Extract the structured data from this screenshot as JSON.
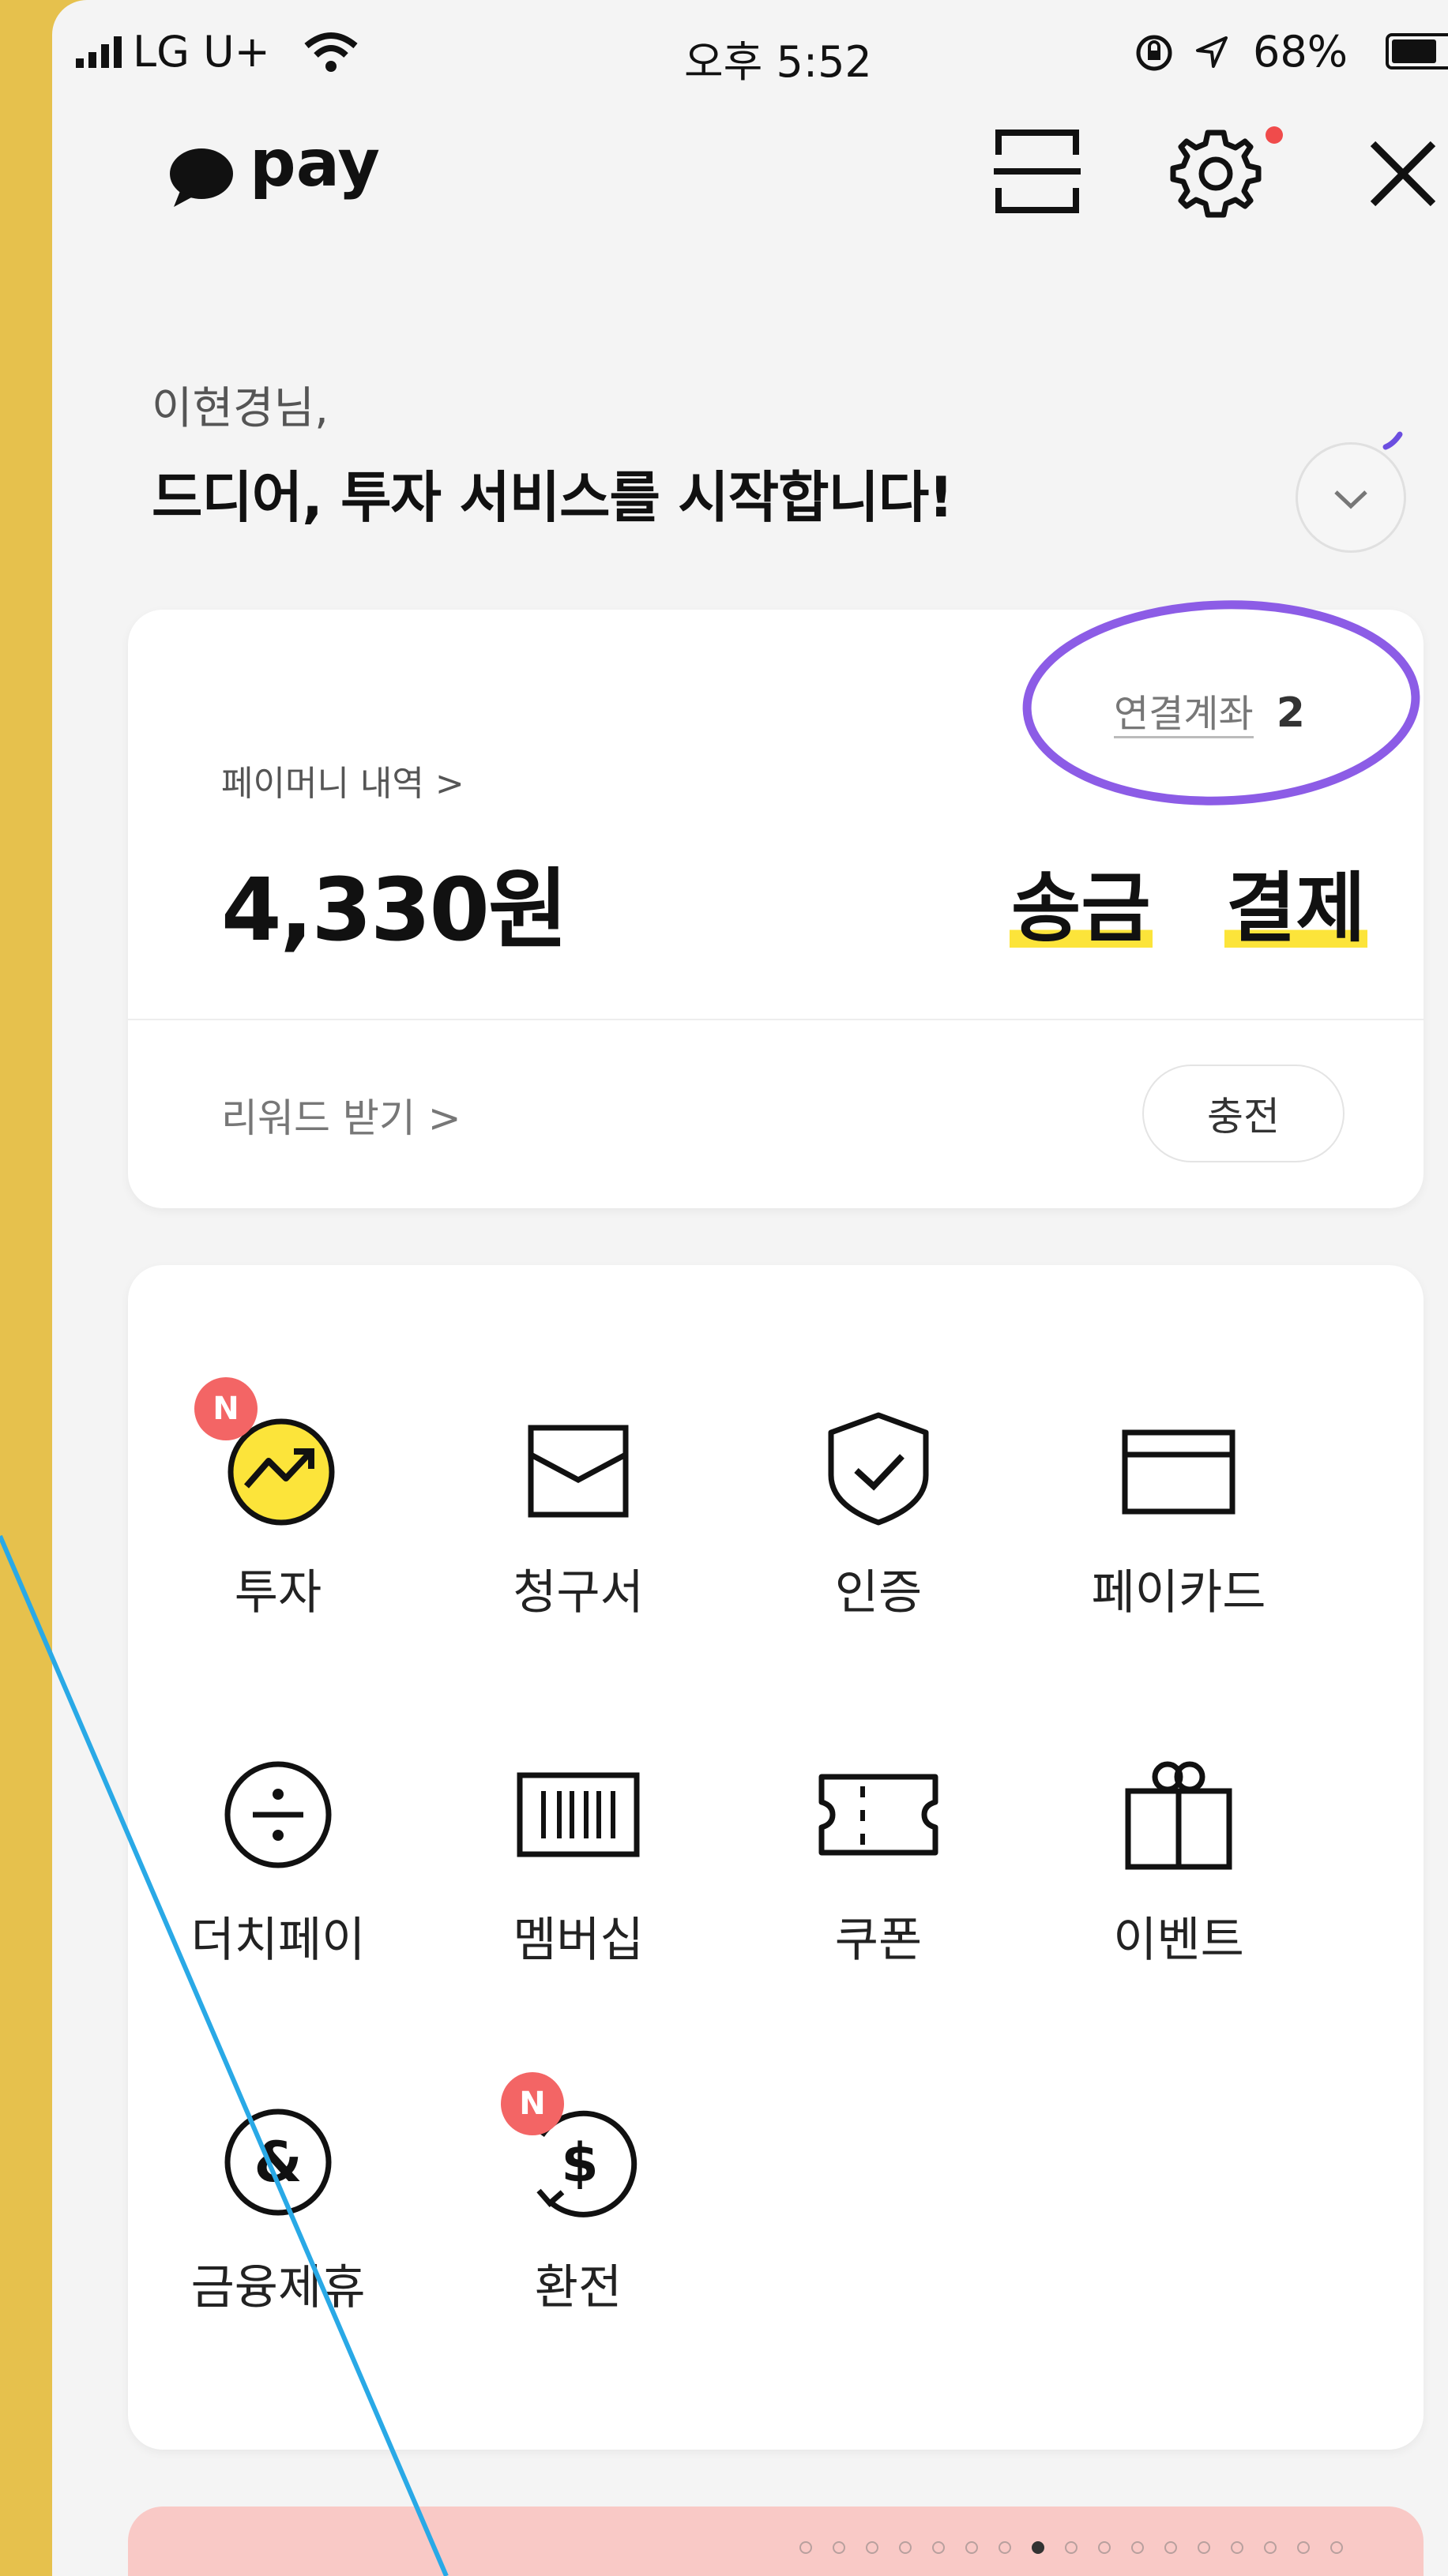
{
  "status_bar": {
    "carrier": "LG U+",
    "time": "오후 5:52",
    "battery": "68%"
  },
  "header": {
    "brand": "pay",
    "icons": [
      "chat-bubble-icon",
      "qr-scan-icon",
      "gear-icon",
      "close-icon"
    ],
    "settings_has_alert": true
  },
  "greeting": {
    "name": "이현경님,",
    "title": "드디어, 투자 서비스를 시작합니다!"
  },
  "money_card": {
    "history_link": "페이머니 내역 >",
    "balance": "4,330원",
    "linked_accounts_label": "연결계좌",
    "linked_accounts_count": "2",
    "send_label": "송금",
    "pay_label": "결제",
    "reward_link": "리워드 받기 >",
    "charge_label": "충전"
  },
  "menu": [
    {
      "label": "투자",
      "icon": "invest-chart-icon",
      "badge": "N"
    },
    {
      "label": "청구서",
      "icon": "envelope-icon",
      "badge": ""
    },
    {
      "label": "인증",
      "icon": "shield-check-icon",
      "badge": ""
    },
    {
      "label": "페이카드",
      "icon": "card-icon",
      "badge": ""
    },
    {
      "label": "더치페이",
      "icon": "divide-icon",
      "badge": ""
    },
    {
      "label": "멤버십",
      "icon": "barcode-icon",
      "badge": ""
    },
    {
      "label": "쿠폰",
      "icon": "ticket-icon",
      "badge": ""
    },
    {
      "label": "이벤트",
      "icon": "gift-icon",
      "badge": ""
    },
    {
      "label": "금융제휴",
      "icon": "ampersand-icon",
      "badge": ""
    },
    {
      "label": "환전",
      "icon": "exchange-dollar-icon",
      "badge": "N"
    }
  ],
  "banner": {
    "page_count": 17,
    "active_page": 7
  },
  "colors": {
    "background_frame": "#E6C14D",
    "screen": "#F4F4F4",
    "highlight": "#FCE43A",
    "annotation_circle": "#8C5CE6",
    "annotation_line": "#29A9E6",
    "badge": "#F36565",
    "banner": "#F9C9C6"
  }
}
